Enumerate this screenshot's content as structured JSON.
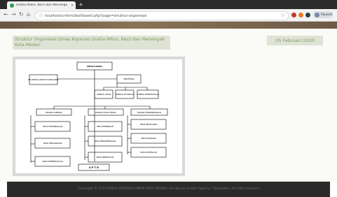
{
  "browser": {
    "tab_title": "Usaha Mikro, Kecil dan Menenga",
    "tab_close": "×",
    "new_tab": "+",
    "url": "localhost/umkm/dashboard.php?page=struktur-organisasi",
    "profile_label": "Paused"
  },
  "page": {
    "title": "Struktur Organisasi Dinas Koperasi Usaha Mikro, Kecil dan Menengah Kota Medan",
    "date": "05 Februari 2020",
    "footer": "Copyright © 2019 DINAS KOPERASI UMKM KOTA MEDAN | Design by Vivatel Agency / Templates | All right reserved"
  },
  "org_chart": {
    "head": "KEPALA DINAS",
    "upt": "U P T D",
    "left_group": "KELOMPOK JABATAN FUNGSIONAL",
    "secretary": "SEKRETARIS",
    "subbag": [
      "SUBBAG UMUM",
      "SUBBAG KEUANGAN",
      "SUBBAG PERENCANAAN"
    ],
    "bidang": [
      "BIDANG KOPERASI",
      "BIDANG USAHA MIKRO",
      "BIDANG PENGEMBANGAN"
    ],
    "seksi_left": [
      "SEKSI KELEMBAGAAN",
      "SEKSI PENGAWASAN",
      "SEKSI PEMBERDAYAAN"
    ],
    "seksi_mid": [
      "SEKSI PEMBINAAN",
      "SEKSI PENGEMBANGAN",
      "SEKSI PEMBIAYAAN"
    ],
    "seksi_right": [
      "SEKSI PEMASARAN",
      "SEKSI PRODUKSI",
      "SEKSI KEMITRAAN"
    ]
  }
}
